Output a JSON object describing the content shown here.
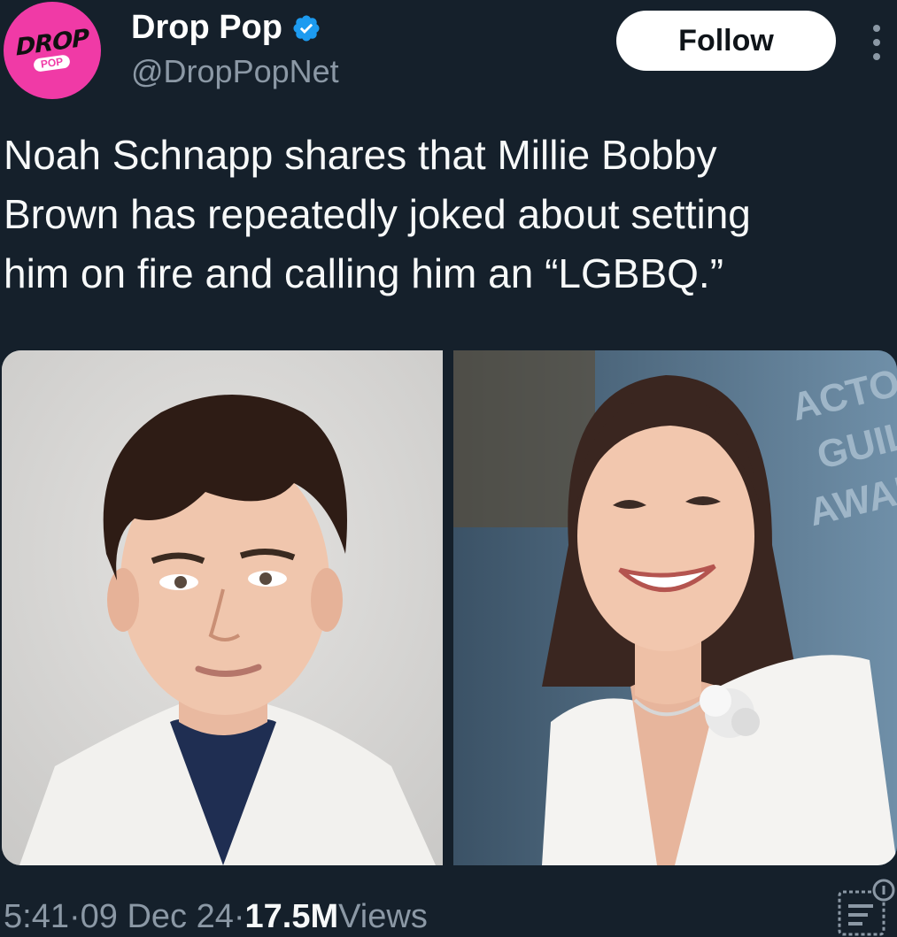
{
  "account": {
    "display_name": "Drop Pop",
    "handle": "@DropPopNet",
    "avatar_text_top": "DROP",
    "avatar_text_bottom": "POP",
    "verified": true
  },
  "actions": {
    "follow_label": "Follow",
    "more_icon": "more-vertical-icon"
  },
  "tweet": {
    "text_lines": [
      "Noah Schnapp shares that Millie Bobby",
      "Brown has repeatedly joked about setting",
      "him on fire and calling him an “LGBBQ.”"
    ]
  },
  "media": {
    "right_photo_backdrop_text": [
      "ACTO",
      "GUILD",
      "AWARDS"
    ]
  },
  "footer": {
    "time": "5:41",
    "separator": " · ",
    "date": "09 Dec 24",
    "views_count": "17.5M",
    "views_label": " Views",
    "analytics_icon": "analytics-icon"
  },
  "colors": {
    "background": "#15202b",
    "avatar": "#f03aa6",
    "verified": "#1d9bf0",
    "secondary_text": "#8b98a5"
  }
}
